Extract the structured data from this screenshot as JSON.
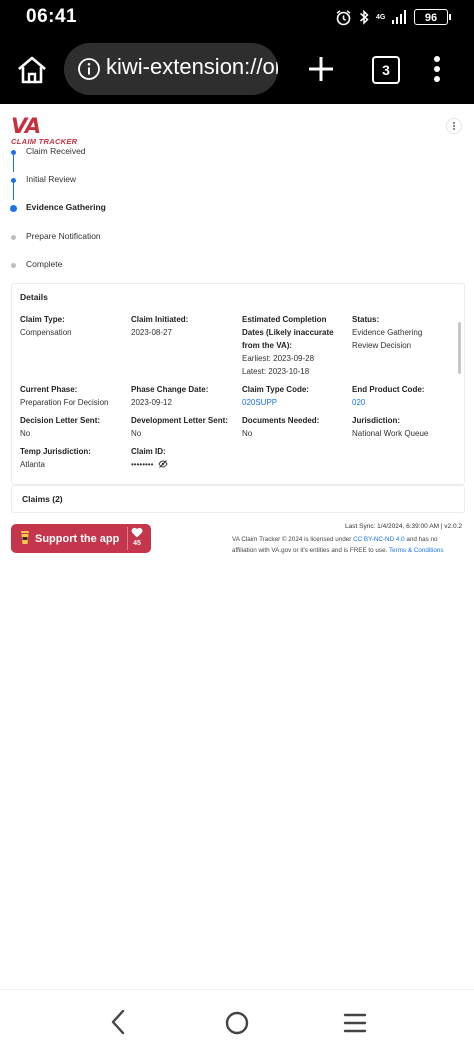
{
  "status_bar": {
    "time": "06:41",
    "battery": "96",
    "network_label": "4G"
  },
  "browser": {
    "url": "kiwi-extension://on",
    "tab_count": "3"
  },
  "app": {
    "logo_text": "VA",
    "logo_subtitle": "CLAIM TRACKER"
  },
  "timeline": {
    "steps": [
      {
        "label": "Claim Received",
        "state": "done"
      },
      {
        "label": "Initial Review",
        "state": "done"
      },
      {
        "label": "Evidence Gathering",
        "state": "current"
      },
      {
        "label": "Prepare Notification",
        "state": "pending"
      },
      {
        "label": "Complete",
        "state": "pending"
      }
    ]
  },
  "details": {
    "title": "Details",
    "claim_type": {
      "label": "Claim Type:",
      "value": "Compensation"
    },
    "claim_initiated": {
      "label": "Claim Initiated:",
      "value": "2023-08-27"
    },
    "estimated_completion": {
      "label": "Estimated Completion Dates (Likely inaccurate from the VA):",
      "earliest": "Earliest: 2023-09-28",
      "latest": "Latest: 2023-10-18"
    },
    "status": {
      "label": "Status:",
      "value": "Evidence Gathering Review Decision"
    },
    "current_phase": {
      "label": "Current Phase:",
      "value": "Preparation For Decision"
    },
    "phase_change_date": {
      "label": "Phase Change Date:",
      "value": "2023-09-12"
    },
    "claim_type_code": {
      "label": "Claim Type Code:",
      "value": "020SUPP"
    },
    "end_product_code": {
      "label": "End Product Code:",
      "value": "020"
    },
    "decision_letter_sent": {
      "label": "Decision Letter Sent:",
      "value": "No"
    },
    "development_letter_sent": {
      "label": "Development Letter Sent:",
      "value": "No"
    },
    "documents_needed": {
      "label": "Documents Needed:",
      "value": "No"
    },
    "jurisdiction": {
      "label": "Jurisdiction:",
      "value": "National Work Queue"
    },
    "temp_jurisdiction": {
      "label": "Temp Jurisdiction:",
      "value": "Atlanta"
    },
    "claim_id": {
      "label": "Claim ID:",
      "value": "••••••••"
    }
  },
  "claims": {
    "label": "Claims (2)"
  },
  "support": {
    "label": "Support the app",
    "likes": "45"
  },
  "footer": {
    "last_sync": "Last Sync: 1/4/2024, 6:39:00 AM | v2.0.2",
    "license_prefix": "VA Claim Tracker © 2024 is licensed under",
    "license_link": "CC BY-NC-ND 4.0",
    "license_mid": "and has no affiliation with VA.gov or it's entities and is FREE to use.",
    "terms_link": "Terms & Conditions"
  },
  "colors": {
    "brand_red": "#c6303e",
    "support_bg": "#c5364d",
    "link_blue": "#1a73e8",
    "bar_black": "#000000"
  }
}
